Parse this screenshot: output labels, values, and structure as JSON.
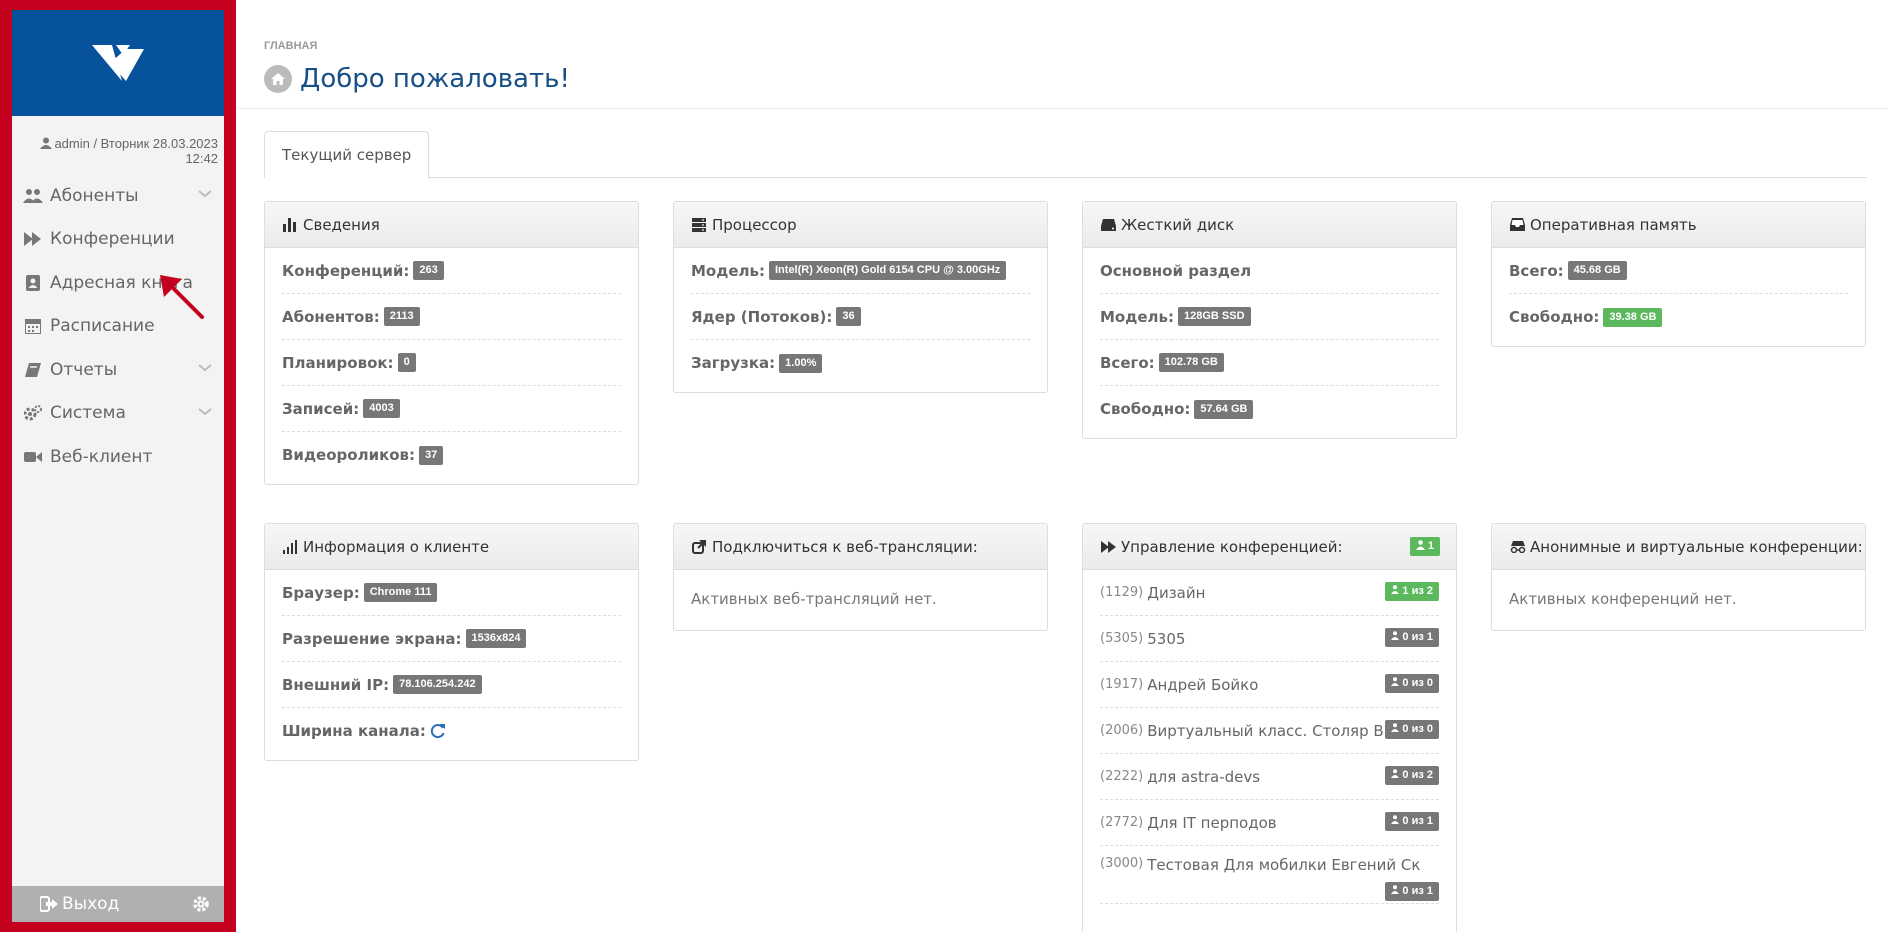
{
  "sidebar": {
    "user_line": "admin / Вторник 28.03.2023 12:42",
    "items": [
      {
        "label": "Абоненты"
      },
      {
        "label": "Конференции"
      },
      {
        "label": "Адресная книга"
      },
      {
        "label": "Расписание"
      },
      {
        "label": "Отчеты"
      },
      {
        "label": "Система"
      },
      {
        "label": "Веб-клиент"
      }
    ],
    "logout_label": "Выход"
  },
  "header": {
    "breadcrumb": "ГЛАВНАЯ",
    "title": "Добро пожаловать!"
  },
  "tabs": [
    {
      "label": "Текущий сервер"
    }
  ],
  "panels": {
    "info": {
      "title": "Сведения",
      "rows": [
        {
          "label": "Конференций:",
          "value": "263"
        },
        {
          "label": "Абонентов:",
          "value": "2113"
        },
        {
          "label": "Планировок:",
          "value": "0"
        },
        {
          "label": "Записей:",
          "value": "4003"
        },
        {
          "label": "Видеороликов:",
          "value": "37"
        }
      ]
    },
    "cpu": {
      "title": "Процессор",
      "rows": [
        {
          "label": "Модель:",
          "value": "Intel(R) Xeon(R) Gold 6154 CPU @ 3.00GHz"
        },
        {
          "label": "Ядер (Потоков):",
          "value": "36"
        },
        {
          "label": "Загрузка:",
          "value": "1.00%"
        }
      ]
    },
    "disk": {
      "title": "Жесткий диск",
      "section": "Основной раздел",
      "rows": [
        {
          "label": "Модель:",
          "value": "128GB SSD"
        },
        {
          "label": "Всего:",
          "value": "102.78 GB"
        },
        {
          "label": "Свободно:",
          "value": "57.64 GB"
        }
      ]
    },
    "ram": {
      "title": "Оперативная память",
      "rows": [
        {
          "label": "Всего:",
          "value": "45.68 GB"
        },
        {
          "label": "Свободно:",
          "value": "39.38 GB"
        }
      ]
    },
    "client": {
      "title": "Информация о клиенте",
      "rows": [
        {
          "label": "Браузер:",
          "value": "Chrome 111"
        },
        {
          "label": "Разрешение экрана:",
          "value": "1536x824"
        },
        {
          "label": "Внешний IP:",
          "value": "78.106.254.242"
        },
        {
          "label": "Ширина канала:"
        }
      ]
    },
    "webcast": {
      "title": "Подключиться к веб-трансляции:",
      "empty": "Активных веб-трансляций нет."
    },
    "conf_mgmt": {
      "title": "Управление конференцией:",
      "count_badge": "1",
      "rows": [
        {
          "id": "(1129)",
          "name": "Дизайн",
          "badge": "1 из 2"
        },
        {
          "id": "(5305)",
          "name": "5305",
          "badge": "0 из 1"
        },
        {
          "id": "(1917)",
          "name": "Андрей Бойко",
          "badge": "0 из 0"
        },
        {
          "id": "(2006)",
          "name": "Виртуальный класс. Столяр В.Л.",
          "badge": "0 из 0"
        },
        {
          "id": "(2222)",
          "name": "для astra-devs",
          "badge": "0 из 2"
        },
        {
          "id": "(2772)",
          "name": "Для IT перподов",
          "badge": "0 из 1"
        },
        {
          "id": "(3000)",
          "name": "Тестовая Для мобилки Евгений Ск",
          "badge": "0 из 1"
        }
      ]
    },
    "anon": {
      "title": "Анонимные и виртуальные конференции:",
      "empty": "Активных конференций нет."
    }
  },
  "colors": {
    "frame_red": "#c3001e",
    "logo_blue": "#07539b",
    "title_blue": "#174f86",
    "badge_gray": "#777777",
    "badge_green": "#5cb85c"
  }
}
